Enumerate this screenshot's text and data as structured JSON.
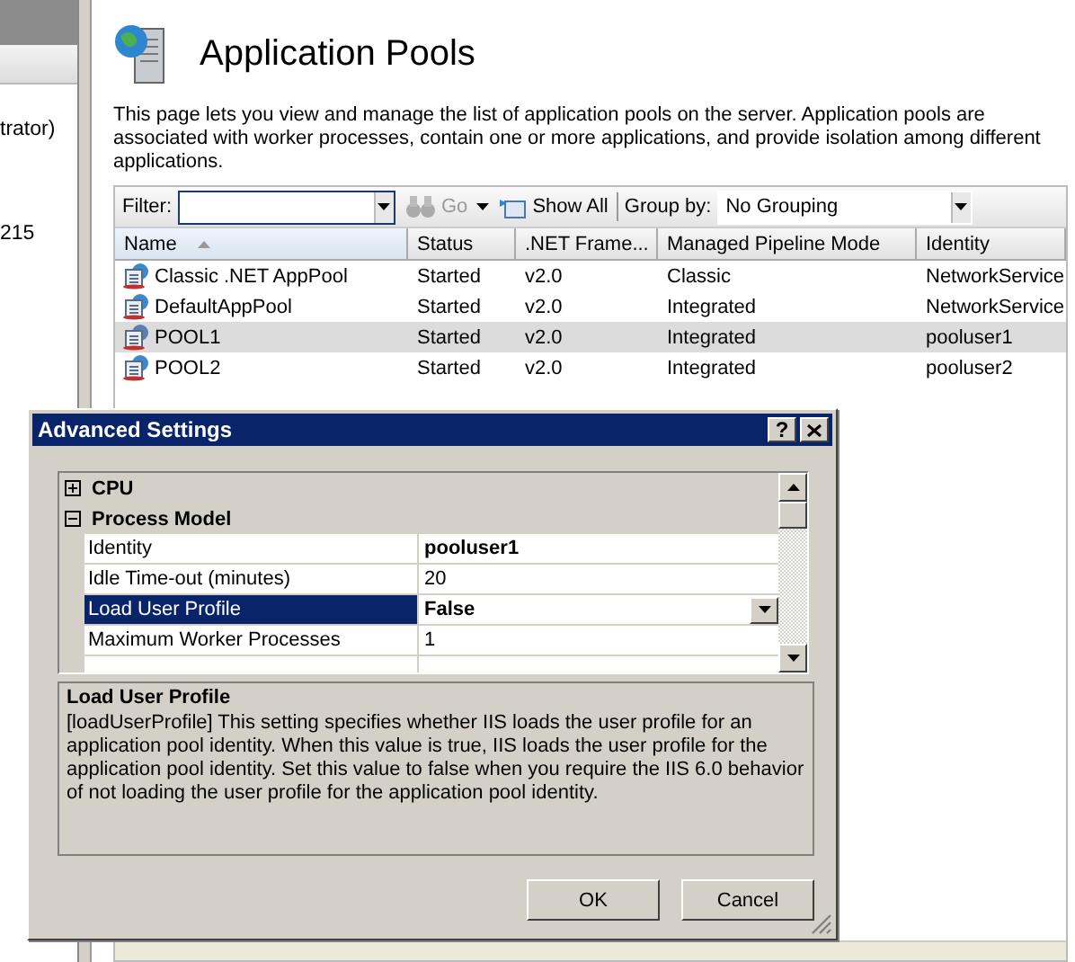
{
  "left_pane": {
    "lines": [
      "trator)",
      "215"
    ]
  },
  "page": {
    "title": "Application Pools",
    "description": "This page lets you view and manage the list of application pools on the server. Application pools are associated with worker processes, contain one or more applications, and provide isolation among different applications."
  },
  "toolbar": {
    "filter_label": "Filter:",
    "go": "Go",
    "show_all": "Show All",
    "group_by_label": "Group by:",
    "group_by_value": "No Grouping"
  },
  "table": {
    "columns": [
      {
        "label": "Name",
        "sorted": true
      },
      {
        "label": "Status",
        "sorted": false
      },
      {
        "label": ".NET Frame...",
        "sorted": false
      },
      {
        "label": "Managed Pipeline Mode",
        "sorted": false
      },
      {
        "label": "Identity",
        "sorted": false
      }
    ],
    "rows": [
      {
        "cells": [
          "Classic .NET AppPool",
          "Started",
          "v2.0",
          "Classic",
          "NetworkService"
        ],
        "selected": false
      },
      {
        "cells": [
          "DefaultAppPool",
          "Started",
          "v2.0",
          "Integrated",
          "NetworkService"
        ],
        "selected": false
      },
      {
        "cells": [
          "POOL1",
          "Started",
          "v2.0",
          "Integrated",
          "pooluser1"
        ],
        "selected": true
      },
      {
        "cells": [
          "POOL2",
          "Started",
          "v2.0",
          "Integrated",
          "pooluser2"
        ],
        "selected": false
      }
    ]
  },
  "dialog": {
    "title": "Advanced Settings",
    "help_button": "?",
    "properties": [
      {
        "kind": "category",
        "label": "CPU",
        "expanded": false
      },
      {
        "kind": "category",
        "label": "Process Model",
        "expanded": true
      },
      {
        "kind": "property",
        "label": "Identity",
        "value": "pooluser1",
        "modified": true,
        "selected": false
      },
      {
        "kind": "property",
        "label": "Idle Time-out (minutes)",
        "value": "20",
        "modified": false,
        "selected": false
      },
      {
        "kind": "property",
        "label": "Load User Profile",
        "value": "False",
        "modified": true,
        "selected": true
      },
      {
        "kind": "property",
        "label": "Maximum Worker Processes",
        "value": "1",
        "modified": false,
        "selected": false
      },
      {
        "kind": "partial"
      }
    ],
    "description": {
      "title": "Load User Profile",
      "text": "[loadUserProfile] This setting specifies whether IIS loads the user profile for an application pool identity. When this value is true, IIS loads the user profile for the application pool identity. Set this value to false when you require the IIS 6.0 behavior of not loading the user profile for the application pool identity."
    },
    "buttons": [
      "OK",
      "Cancel"
    ]
  }
}
